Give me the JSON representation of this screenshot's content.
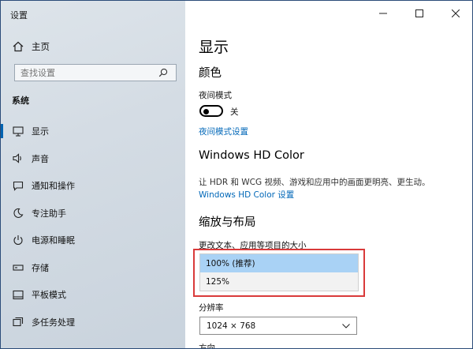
{
  "window": {
    "title": "设置"
  },
  "sidebar": {
    "home_label": "主页",
    "search_placeholder": "查找设置",
    "section": "系统",
    "items": [
      {
        "label": "显示",
        "icon": "monitor-icon",
        "active": true
      },
      {
        "label": "声音",
        "icon": "speaker-icon"
      },
      {
        "label": "通知和操作",
        "icon": "notification-icon"
      },
      {
        "label": "专注助手",
        "icon": "moon-icon"
      },
      {
        "label": "电源和睡眠",
        "icon": "power-icon"
      },
      {
        "label": "存储",
        "icon": "storage-icon"
      },
      {
        "label": "平板模式",
        "icon": "tablet-icon"
      },
      {
        "label": "多任务处理",
        "icon": "multitask-icon"
      }
    ]
  },
  "main": {
    "page_title": "显示",
    "color_heading": "颜色",
    "night_mode_label": "夜间模式",
    "night_mode_state": "关",
    "night_mode_link": "夜间模式设置",
    "hdr_heading": "Windows HD Color",
    "hdr_desc": "让 HDR 和 WCG 视频、游戏和应用中的画面更明亮、更生动。",
    "hdr_link": "Windows HD Color 设置",
    "scale_heading": "缩放与布局",
    "scale_label": "更改文本、应用等项目的大小",
    "scale_options": [
      {
        "label": "100% (推荐)",
        "selected": true
      },
      {
        "label": "125%",
        "selected": false
      }
    ],
    "resolution_label": "分辨率",
    "resolution_value": "1024 × 768",
    "cut_label": "方向"
  },
  "colors": {
    "accent": "#0067b8",
    "highlight": "#d93a3a",
    "selected_option": "#a9d2f5"
  }
}
